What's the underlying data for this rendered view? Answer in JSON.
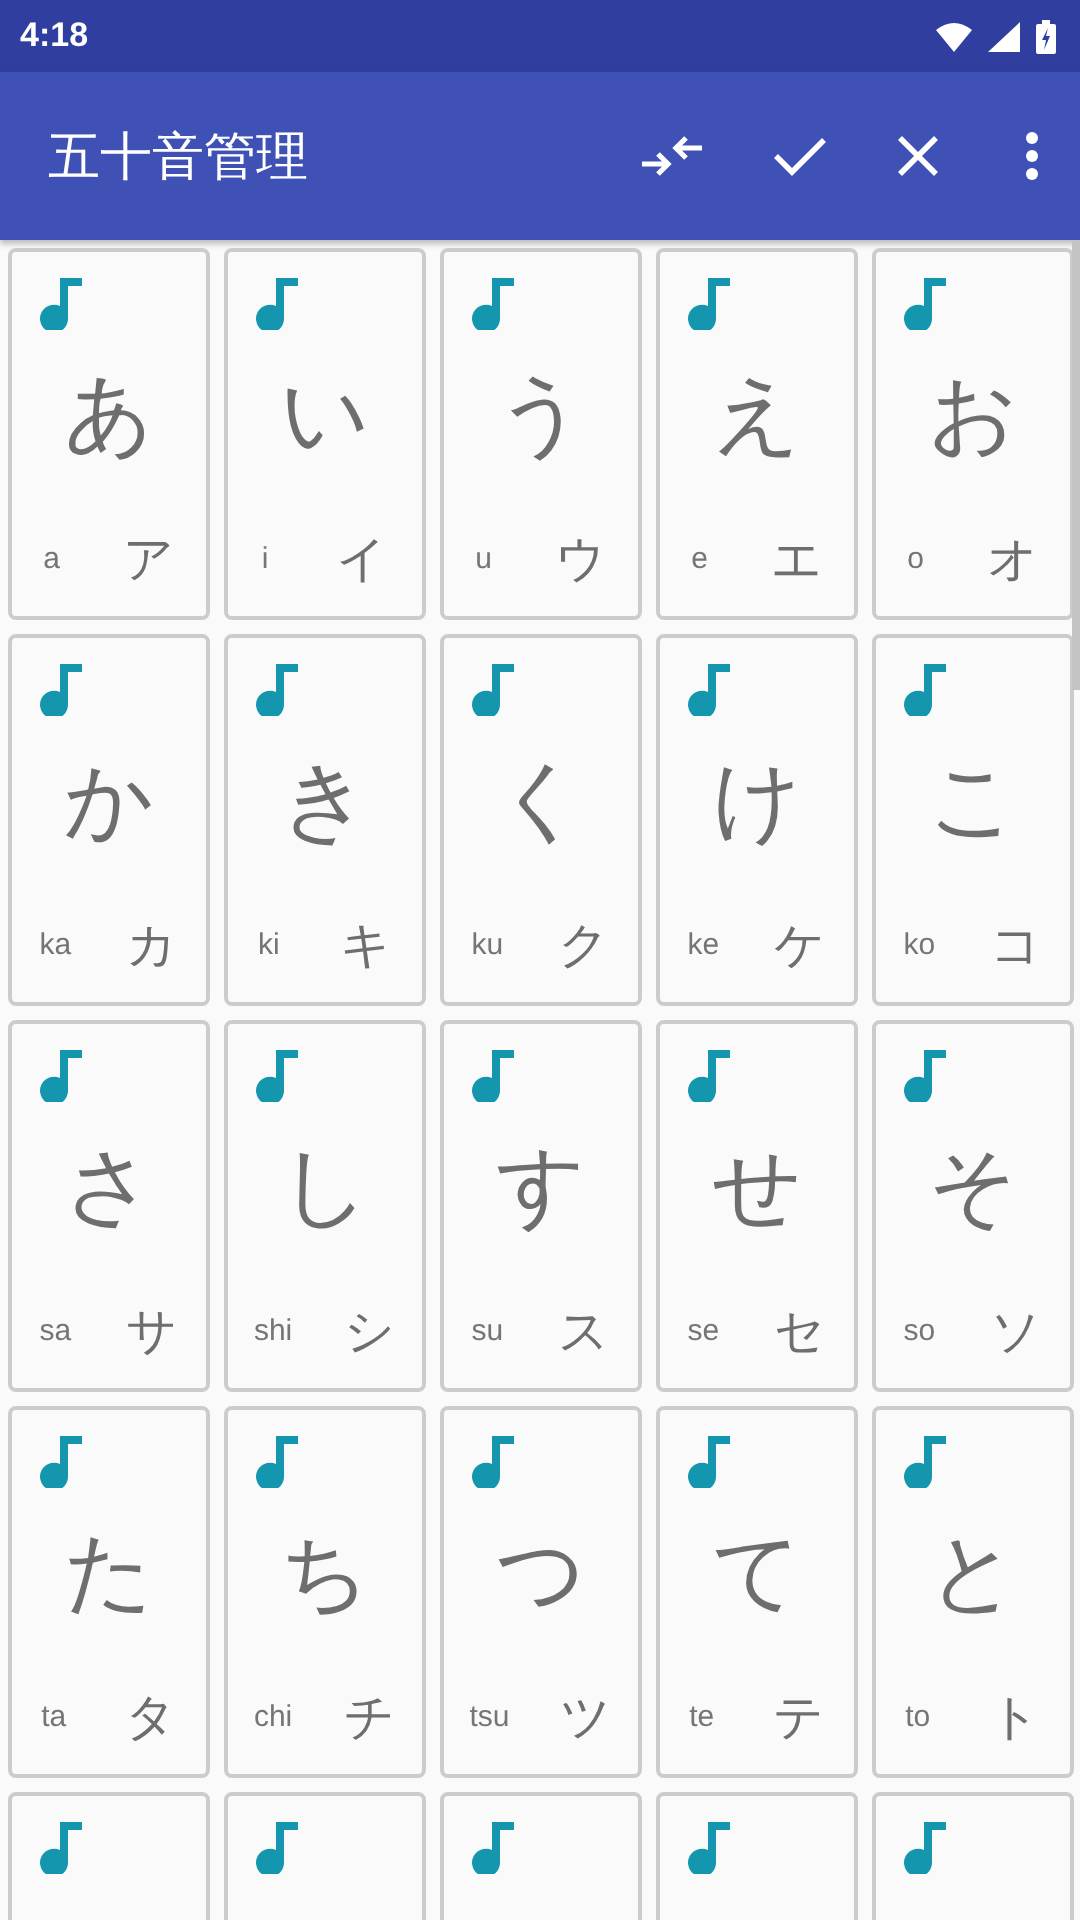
{
  "status_bar": {
    "time": "4:18"
  },
  "toolbar": {
    "title": "五十音管理"
  },
  "cards": [
    {
      "kind": "full",
      "kana": "あ",
      "romaji": "a",
      "katakana": "ア"
    },
    {
      "kind": "full",
      "kana": "い",
      "romaji": "i",
      "katakana": "イ"
    },
    {
      "kind": "full",
      "kana": "う",
      "romaji": "u",
      "katakana": "ウ"
    },
    {
      "kind": "full",
      "kana": "え",
      "romaji": "e",
      "katakana": "エ"
    },
    {
      "kind": "full",
      "kana": "お",
      "romaji": "o",
      "katakana": "オ"
    },
    {
      "kind": "full",
      "kana": "か",
      "romaji": "ka",
      "katakana": "カ"
    },
    {
      "kind": "full",
      "kana": "き",
      "romaji": "ki",
      "katakana": "キ"
    },
    {
      "kind": "full",
      "kana": "く",
      "romaji": "ku",
      "katakana": "ク"
    },
    {
      "kind": "full",
      "kana": "け",
      "romaji": "ke",
      "katakana": "ケ"
    },
    {
      "kind": "full",
      "kana": "こ",
      "romaji": "ko",
      "katakana": "コ"
    },
    {
      "kind": "full",
      "kana": "さ",
      "romaji": "sa",
      "katakana": "サ"
    },
    {
      "kind": "full",
      "kana": "し",
      "romaji": "shi",
      "katakana": "シ"
    },
    {
      "kind": "full",
      "kana": "す",
      "romaji": "su",
      "katakana": "ス"
    },
    {
      "kind": "full",
      "kana": "せ",
      "romaji": "se",
      "katakana": "セ"
    },
    {
      "kind": "full",
      "kana": "そ",
      "romaji": "so",
      "katakana": "ソ"
    },
    {
      "kind": "full",
      "kana": "た",
      "romaji": "ta",
      "katakana": "タ"
    },
    {
      "kind": "full",
      "kana": "ち",
      "romaji": "chi",
      "katakana": "チ"
    },
    {
      "kind": "full",
      "kana": "つ",
      "romaji": "tsu",
      "katakana": "ツ"
    },
    {
      "kind": "full",
      "kana": "て",
      "romaji": "te",
      "katakana": "テ"
    },
    {
      "kind": "full",
      "kana": "と",
      "romaji": "to",
      "katakana": "ト"
    },
    {
      "kind": "cut"
    },
    {
      "kind": "cut"
    },
    {
      "kind": "cut"
    },
    {
      "kind": "cut"
    },
    {
      "kind": "cut"
    }
  ]
}
